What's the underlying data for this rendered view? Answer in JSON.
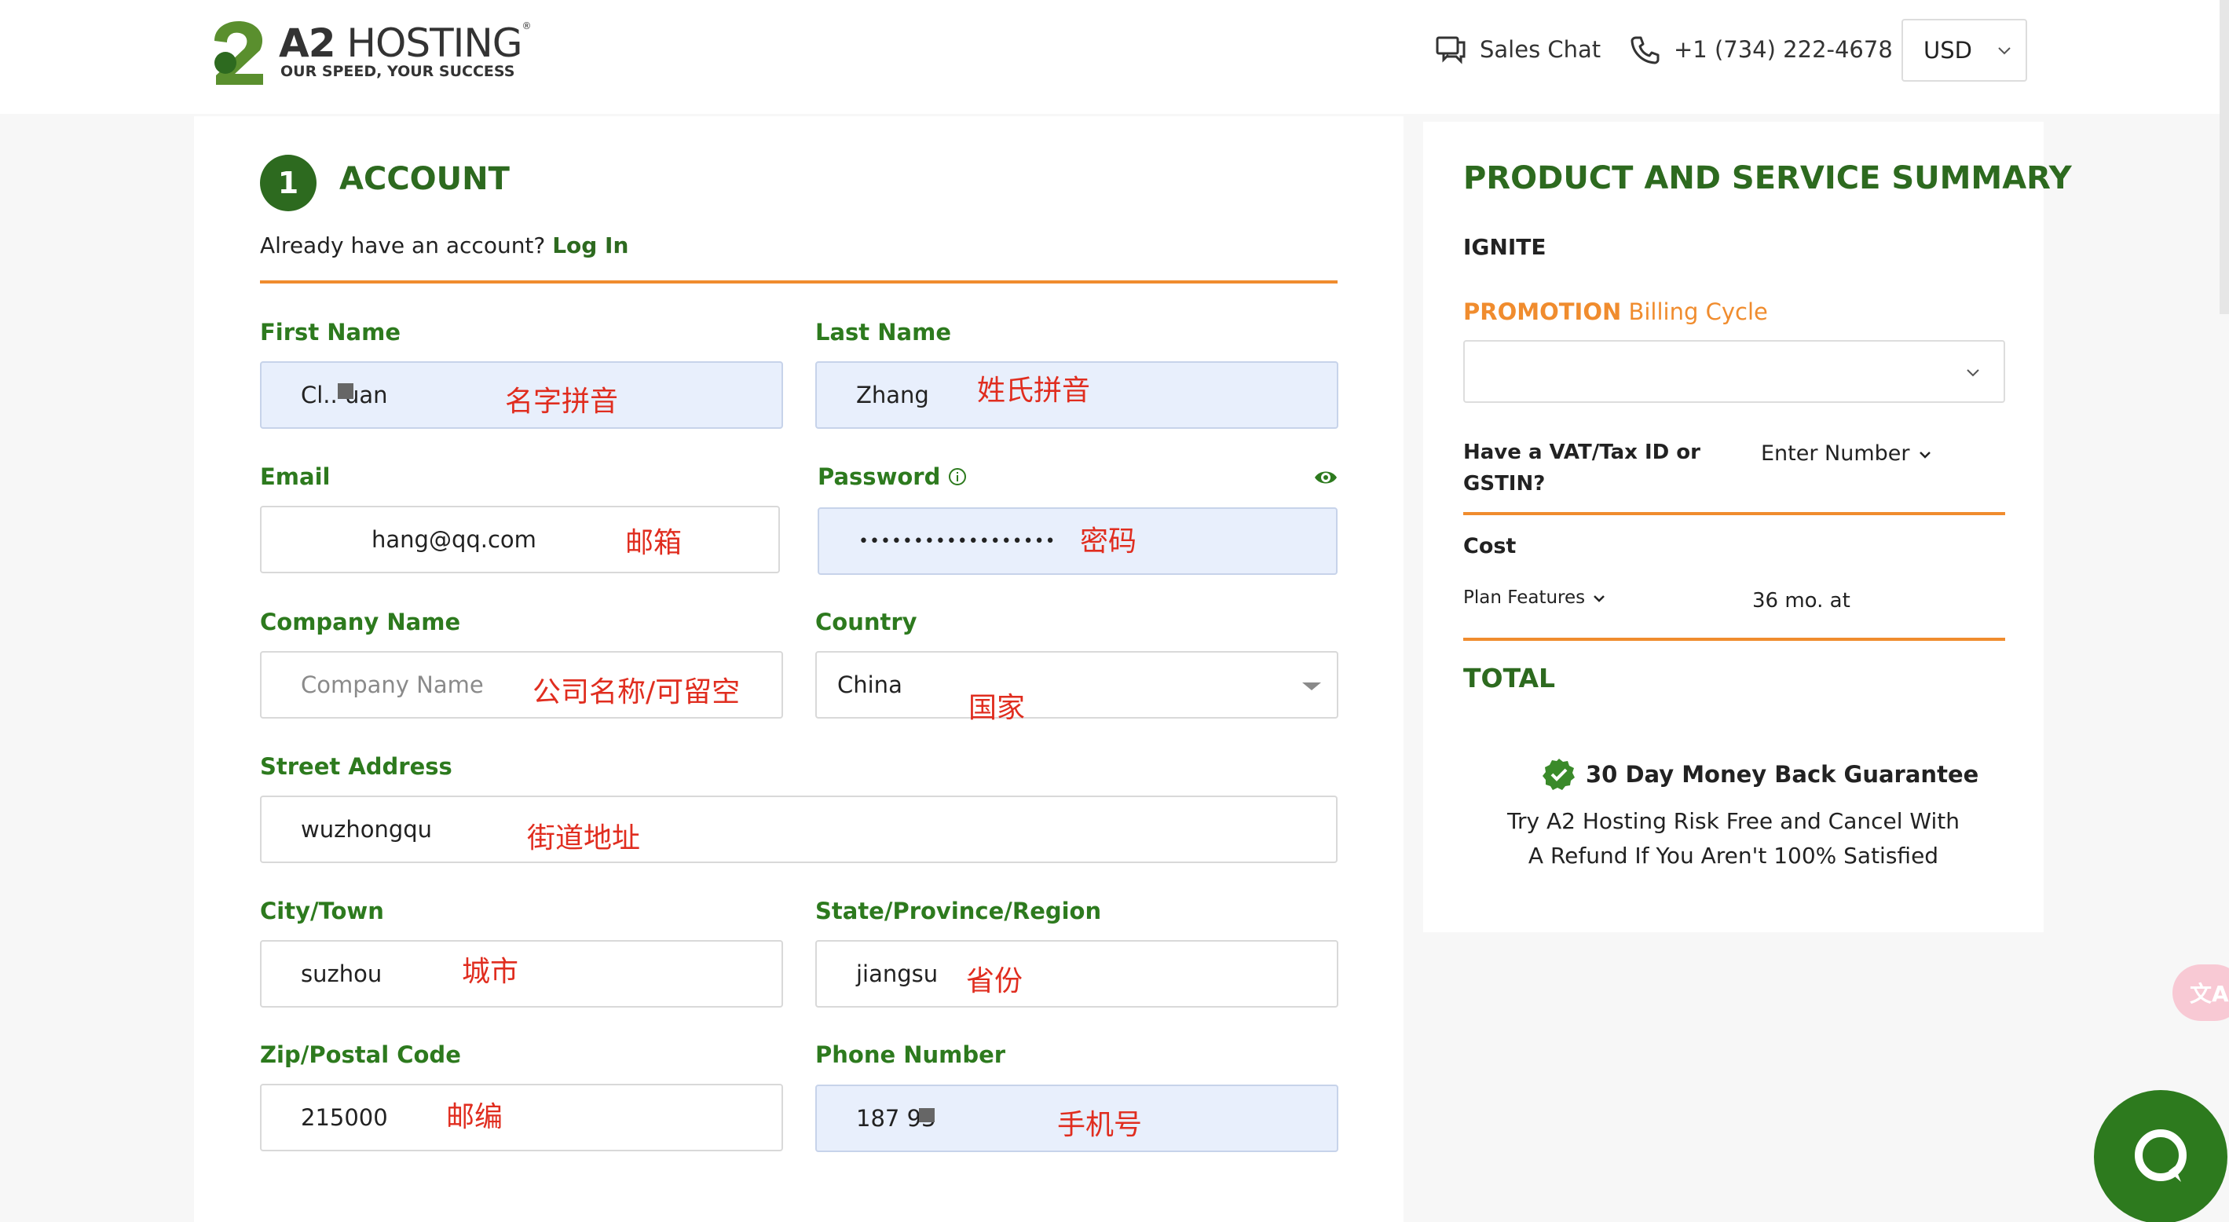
{
  "header": {
    "logo": {
      "brand_bold": "A2",
      "brand_rest": "HOSTING",
      "reg": "®",
      "tagline": "OUR SPEED, YOUR SUCCESS"
    },
    "sales_chat": "Sales Chat",
    "phone": "+1 (734) 222-4678",
    "currency": "USD"
  },
  "account": {
    "step_number": "1",
    "title": "ACCOUNT",
    "login_prompt": "Already have an account?",
    "login_link": "Log In"
  },
  "fields": {
    "first_name": {
      "label": "First Name",
      "value": "Cl..   uan",
      "annotation": "名字拼音"
    },
    "last_name": {
      "label": "Last Name",
      "value": "Zhang",
      "annotation": "姓氏拼音"
    },
    "email": {
      "label": "Email",
      "value": "hang@qq.com",
      "annotation": "邮箱"
    },
    "password": {
      "label": "Password",
      "value": "••••••••••••••••••",
      "annotation": "密码"
    },
    "company": {
      "label": "Company Name",
      "placeholder": "Company Name",
      "annotation": "公司名称/可留空"
    },
    "country": {
      "label": "Country",
      "value": "China",
      "annotation": "国家"
    },
    "street": {
      "label": "Street Address",
      "value": "wuzhongqu",
      "annotation": "街道地址"
    },
    "city": {
      "label": "City/Town",
      "value": "suzhou",
      "annotation": "城市"
    },
    "state": {
      "label": "State/Province/Region",
      "value": "jiangsu",
      "annotation": "省份"
    },
    "zip": {
      "label": "Zip/Postal Code",
      "value": "215000",
      "annotation": "邮编"
    },
    "phone": {
      "label": "Phone Number",
      "value": "187    93",
      "annotation": "手机号"
    }
  },
  "summary": {
    "title": "PRODUCT AND SERVICE SUMMARY",
    "plan": "IGNITE",
    "promo_label": "PROMOTION",
    "billing_cycle_label": "Billing Cycle",
    "vat_question_line1": "Have a VAT/Tax ID or",
    "vat_question_line2": "GSTIN?",
    "enter_number": "Enter Number",
    "cost_label": "Cost",
    "plan_features": "Plan Features",
    "term": "36 mo. at",
    "total_label": "TOTAL",
    "guarantee_title": "30 Day Money Back Guarantee",
    "guarantee_line1": "Try A2 Hosting Risk Free and Cancel With",
    "guarantee_line2": "A Refund If You Aren't 100% Satisfied"
  },
  "widgets": {
    "translate_glyph": "文A"
  },
  "colors": {
    "brand_green": "#2d6a1f",
    "label_green": "#2d7a1e",
    "accent_orange": "#f08c2e",
    "annotation_red": "#e02d1f",
    "autofill_blue": "#e8effc"
  }
}
